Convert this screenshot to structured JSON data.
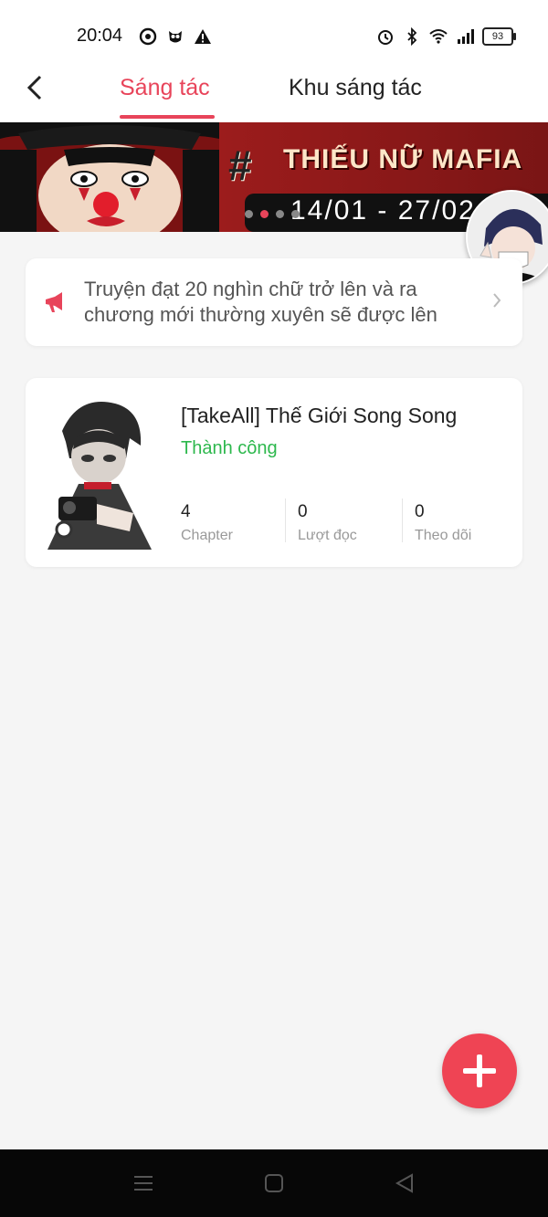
{
  "status_bar": {
    "time": "20:04",
    "battery": "93",
    "left_icons": [
      "chrome-icon",
      "owl-icon",
      "warning-icon"
    ],
    "right_icons": [
      "alarm-icon",
      "bluetooth-icon",
      "wifi-icon",
      "signal-icon",
      "battery-icon"
    ]
  },
  "nav": {
    "tabs": [
      {
        "label": "Sáng tác",
        "active": true
      },
      {
        "label": "Khu sáng tác",
        "active": false
      }
    ],
    "accent_color": "#e8445a"
  },
  "banner": {
    "hashtag": "#",
    "title": "THIẾU NỮ MAFIA",
    "date_range": "14/01 - 27/02",
    "active_dot": 1,
    "dot_count": 4
  },
  "notice": {
    "text": "Truyện đạt 20 nghìn chữ trở lên và ra chương mới thường xuyên sẽ được lên"
  },
  "story": {
    "title": "[TakeAll] Thế Giới Song Song",
    "status": "Thành công",
    "status_color": "#2db84d",
    "stats": [
      {
        "value": "4",
        "label": "Chapter"
      },
      {
        "value": "0",
        "label": "Lượt đọc"
      },
      {
        "value": "0",
        "label": "Theo dõi"
      }
    ]
  },
  "fab": {
    "icon": "plus-icon",
    "color": "#ef4454"
  },
  "system_nav": [
    "menu-icon",
    "home-icon",
    "back-triangle-icon"
  ]
}
